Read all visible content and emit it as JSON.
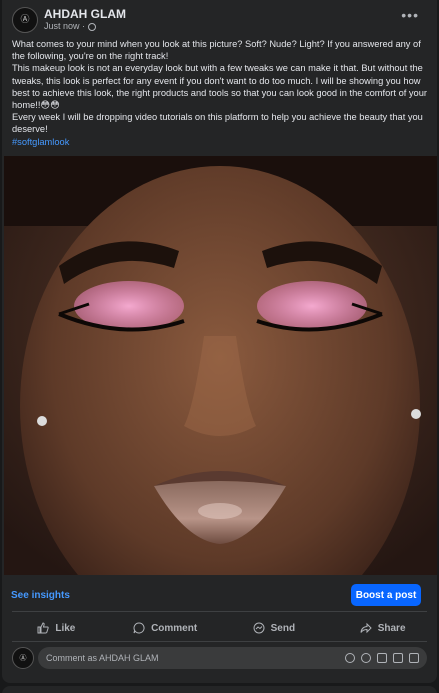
{
  "post": {
    "page_name": "AHDAH GLAM",
    "timestamp": "Just now ·",
    "avatar_text": "AHDAH GLAM",
    "more_label": "•••",
    "paragraphs": [
      "What comes to your mind when you look at this picture? Soft? Nude? Light? If you answered any of the following, you're on the right track!",
      "This makeup look is not an everyday look but with a few tweaks we can make it that. But without the tweaks, this look is perfect for any event if you don't want to do too much. I will be showing you how best to achieve this look, the right products and tools so that you can look good in the comfort of your home!!😳😳",
      "Every week I will be dropping video tutorials on this platform to help you achieve the beauty that you deserve!"
    ],
    "hashtag": "#softglamlook"
  },
  "insights": {
    "see_insights": "See insights",
    "boost": "Boost a post"
  },
  "actions": {
    "like": "Like",
    "comment": "Comment",
    "send": "Send",
    "share": "Share"
  },
  "comment": {
    "placeholder": "Comment as AHDAH GLAM"
  },
  "colors": {
    "background": "#18191a",
    "card": "#242526",
    "accent": "#0866ff",
    "link": "#4599ff"
  }
}
